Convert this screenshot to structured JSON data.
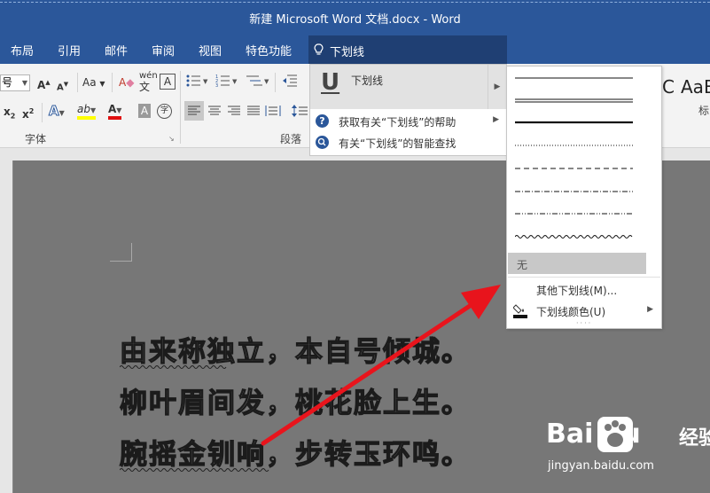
{
  "window": {
    "title": "新建 Microsoft Word 文档.docx  -  Word"
  },
  "tabs": [
    {
      "label": "布局"
    },
    {
      "label": "引用"
    },
    {
      "label": "邮件"
    },
    {
      "label": "审阅"
    },
    {
      "label": "视图"
    },
    {
      "label": "特色功能"
    }
  ],
  "tell_me": {
    "query": "下划线",
    "icon": "lightbulb-icon"
  },
  "ribbon": {
    "font_size_value": "号",
    "font_group_label": "字体",
    "paragraph_group_label": "段落",
    "style_preview_c": "C",
    "style_preview_aab": "AaB",
    "style_label_partial": "标",
    "buttons": {
      "grow": "A",
      "shrink": "A",
      "change_case": "Aa",
      "pinyin": "wén",
      "subscript": "x",
      "superscript": "x",
      "sub_mark": "2",
      "sup_mark": "2",
      "text_effect": "A",
      "highlight": "ab",
      "font_color": "A",
      "char_shading": "A",
      "enclose": "字"
    }
  },
  "tellme_menu": {
    "first_item": {
      "label": "下划线",
      "icon": "underline-u-icon"
    },
    "items": [
      {
        "label": "获取有关“下划线”的帮助",
        "icon": "help-icon"
      },
      {
        "label": "有关“下划线”的智能查找",
        "icon": "smart-lookup-icon"
      }
    ]
  },
  "underline_submenu": {
    "styles": [
      "single",
      "double",
      "thick",
      "dotted",
      "dashed",
      "dash-dot",
      "dash-dot-dot",
      "wave"
    ],
    "none_label": "无",
    "more_label": "其他下划线(M)...",
    "color_label": "下划线颜色(U)",
    "more_accel": "M",
    "color_accel": "U"
  },
  "document": {
    "lines": [
      "由来称独立，本自号倾城。",
      "柳叶眉间发，桃花脸上生。",
      "腕摇金钏响，步转玉环鸣。"
    ]
  },
  "watermark": {
    "logo_text": "Bai  du",
    "cn_text": "经验",
    "url": "jingyan.baidu.com"
  },
  "colors": {
    "accent": "#2b579a",
    "arrow": "#e8141c"
  }
}
